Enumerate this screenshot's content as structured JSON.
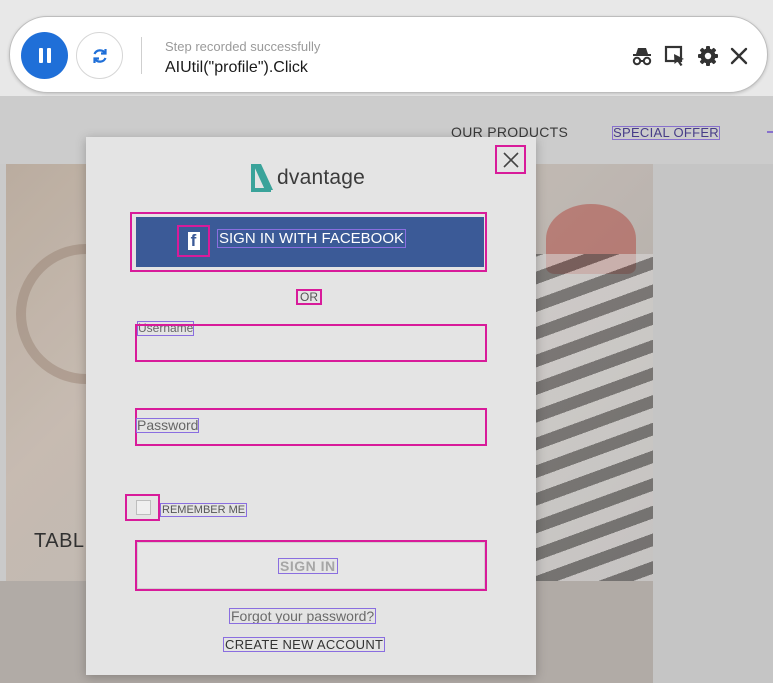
{
  "recorder": {
    "status": "Step recorded successfully",
    "step": "AIUtil(\"profile\").Click",
    "icons": [
      "pause-icon",
      "refresh-icon",
      "spy-icon",
      "object-select-icon",
      "gear-icon",
      "close-icon"
    ]
  },
  "site": {
    "nav": {
      "products": "OUR PRODUCTS",
      "special_offer": "SPECIAL OFFER"
    },
    "hero_text": "TABL"
  },
  "modal": {
    "logo_text": "dvantage",
    "facebook_button": "SIGN IN WITH FACEBOOK",
    "facebook_icon_glyph": "f",
    "or_text": "OR",
    "username_label": "Username",
    "password_label": "Password",
    "remember_me": "REMEMBER ME",
    "sign_in": "SIGN IN",
    "forgot_password": "Forgot your password?",
    "create_account": "CREATE NEW ACCOUNT"
  },
  "colors": {
    "recorder_accent": "#1f6fd8",
    "facebook_blue": "#3b5a97",
    "highlight_pink": "#d81b9a",
    "highlight_purple": "#8a6ee0",
    "logo_teal": "#3aa39a"
  }
}
